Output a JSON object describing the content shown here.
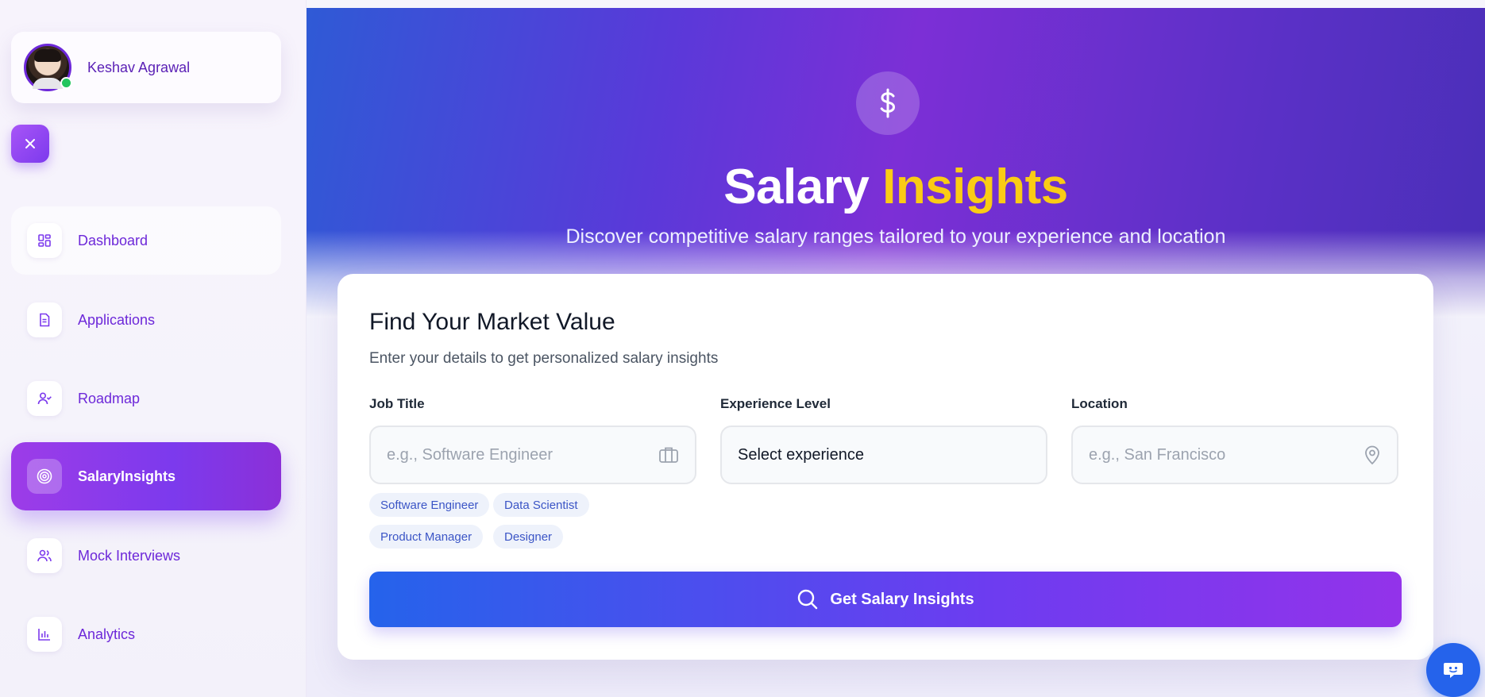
{
  "sidebar": {
    "profile": {
      "name": "Keshav Agrawal",
      "online": true
    },
    "items": [
      {
        "label": "Dashboard",
        "icon": "dashboard-grid-icon",
        "active": false
      },
      {
        "label": "Applications",
        "icon": "document-icon",
        "active": false
      },
      {
        "label": "Roadmap",
        "icon": "user-check-icon",
        "active": false
      },
      {
        "label": "SalaryInsights",
        "icon": "target-icon",
        "active": true
      },
      {
        "label": "Mock Interviews",
        "icon": "users-icon",
        "active": false
      },
      {
        "label": "Analytics",
        "icon": "bar-chart-icon",
        "active": false
      }
    ]
  },
  "hero": {
    "icon": "dollar-icon",
    "title_main": "Salary",
    "title_accent": "Insights",
    "subtitle": "Discover competitive salary ranges tailored to your experience and location"
  },
  "form": {
    "title": "Find Your Market Value",
    "subtitle": "Enter your details to get personalized salary insights",
    "job_title": {
      "label": "Job Title",
      "placeholder": "e.g., Software Engineer",
      "icon": "briefcase-icon",
      "suggestions": [
        "Software Engineer",
        "Data Scientist",
        "Product Manager",
        "Designer"
      ]
    },
    "experience": {
      "label": "Experience Level",
      "value": "Select experience"
    },
    "location": {
      "label": "Location",
      "placeholder": "e.g., San Francisco",
      "icon": "map-pin-icon"
    },
    "submit_label": "Get Salary Insights"
  },
  "colors": {
    "brand_purple": "#7c3aed",
    "accent_yellow": "#facc15",
    "cta_blue": "#2563eb",
    "online_green": "#22c55e"
  }
}
